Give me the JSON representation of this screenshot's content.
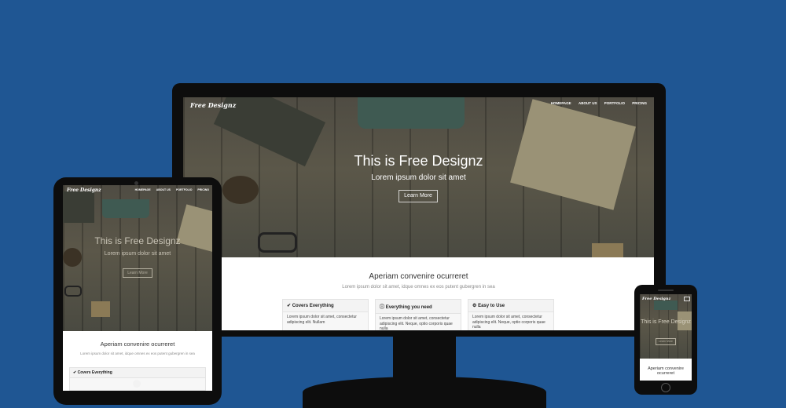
{
  "brand": "Free Designz",
  "nav": [
    "HOMEPAGE",
    "ABOUT US",
    "PORTFOLIO",
    "PRICING"
  ],
  "hero": {
    "title": "This is Free Designz",
    "subtitle": "Lorem ipsum dolor sit amet",
    "button": "Learn More"
  },
  "section": {
    "title": "Aperiam convenire ocurreret",
    "subtitle": "Lorem ipsum dolor sit amet, idque omnes ex eos putent gubergren in sea"
  },
  "features": [
    {
      "icon": "check-icon",
      "title": "Covers Everything",
      "body": "Lorem ipsum dolor sit amet, consectetur adipiscing elit. Nullam"
    },
    {
      "icon": "info-icon",
      "title": "Everything you need",
      "body": "Lorem ipsum dolor sit amet, consectetur adipiscing elit. Neque, optio corporis quae nulla"
    },
    {
      "icon": "gear-icon",
      "title": "Easy to Use",
      "body": "Lorem ipsum dolor sit amet, consectetur adipiscing elit. Neque, optio corporis quae nulla"
    }
  ],
  "colors": {
    "background": "#1f5693",
    "device": "#111111",
    "hero_overlay": "#4f4c43"
  }
}
